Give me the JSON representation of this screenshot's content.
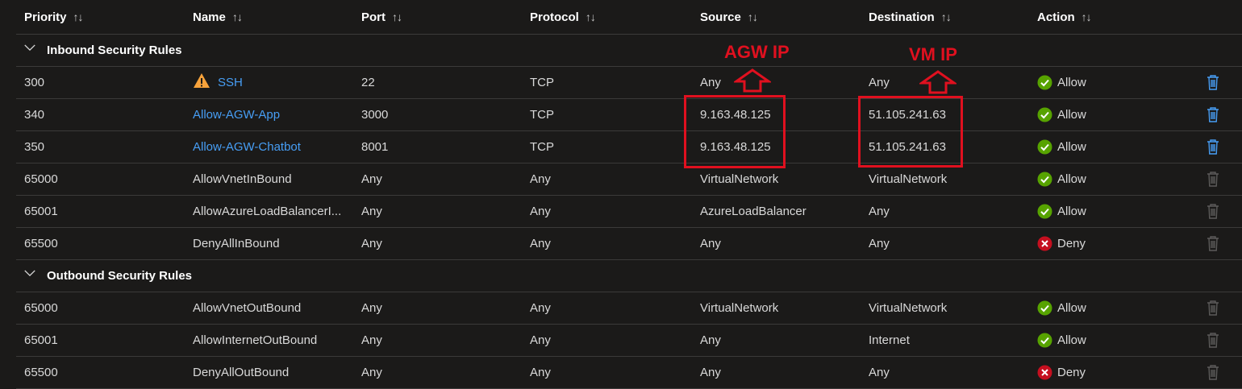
{
  "columns": [
    {
      "label": "Priority"
    },
    {
      "label": "Name"
    },
    {
      "label": "Port"
    },
    {
      "label": "Protocol"
    },
    {
      "label": "Source"
    },
    {
      "label": "Destination"
    },
    {
      "label": "Action"
    }
  ],
  "sort_glyph": "↑↓",
  "inbound": {
    "title": "Inbound Security Rules",
    "rules": [
      {
        "priority": "300",
        "name": "SSH",
        "warning": true,
        "link": true,
        "port": "22",
        "protocol": "TCP",
        "source": "Any",
        "destination": "Any",
        "action": "Allow",
        "deletable": true
      },
      {
        "priority": "340",
        "name": "Allow-AGW-App",
        "warning": false,
        "link": true,
        "port": "3000",
        "protocol": "TCP",
        "source": "9.163.48.125",
        "destination": "51.105.241.63",
        "action": "Allow",
        "deletable": true
      },
      {
        "priority": "350",
        "name": "Allow-AGW-Chatbot",
        "warning": false,
        "link": true,
        "port": "8001",
        "protocol": "TCP",
        "source": "9.163.48.125",
        "destination": "51.105.241.63",
        "action": "Allow",
        "deletable": true
      },
      {
        "priority": "65000",
        "name": "AllowVnetInBound",
        "warning": false,
        "link": false,
        "port": "Any",
        "protocol": "Any",
        "source": "VirtualNetwork",
        "destination": "VirtualNetwork",
        "action": "Allow",
        "deletable": false
      },
      {
        "priority": "65001",
        "name": "AllowAzureLoadBalancerI...",
        "warning": false,
        "link": false,
        "port": "Any",
        "protocol": "Any",
        "source": "AzureLoadBalancer",
        "destination": "Any",
        "action": "Allow",
        "deletable": false
      },
      {
        "priority": "65500",
        "name": "DenyAllInBound",
        "warning": false,
        "link": false,
        "port": "Any",
        "protocol": "Any",
        "source": "Any",
        "destination": "Any",
        "action": "Deny",
        "deletable": false
      }
    ]
  },
  "outbound": {
    "title": "Outbound Security Rules",
    "rules": [
      {
        "priority": "65000",
        "name": "AllowVnetOutBound",
        "warning": false,
        "link": false,
        "port": "Any",
        "protocol": "Any",
        "source": "VirtualNetwork",
        "destination": "VirtualNetwork",
        "action": "Allow",
        "deletable": false
      },
      {
        "priority": "65001",
        "name": "AllowInternetOutBound",
        "warning": false,
        "link": false,
        "port": "Any",
        "protocol": "Any",
        "source": "Any",
        "destination": "Internet",
        "action": "Allow",
        "deletable": false
      },
      {
        "priority": "65500",
        "name": "DenyAllOutBound",
        "warning": false,
        "link": false,
        "port": "Any",
        "protocol": "Any",
        "source": "Any",
        "destination": "Any",
        "action": "Deny",
        "deletable": false
      }
    ]
  },
  "annotations": {
    "source_label": "AGW IP",
    "destination_label": "VM IP",
    "color": "#e0101f"
  },
  "colors": {
    "background": "#1b1a19",
    "link": "#479ef5",
    "allow": "#57a300",
    "deny": "#c50f1f",
    "warning": "#f7a23b",
    "delete_enabled": "#479ef5",
    "delete_disabled": "#5c5b5a"
  },
  "icons": {
    "allow": "check-circle-icon",
    "deny": "x-circle-icon",
    "warning": "warning-triangle-icon",
    "delete": "trash-icon",
    "collapse": "chevron-down-icon",
    "sort": "sort-arrows-icon"
  }
}
